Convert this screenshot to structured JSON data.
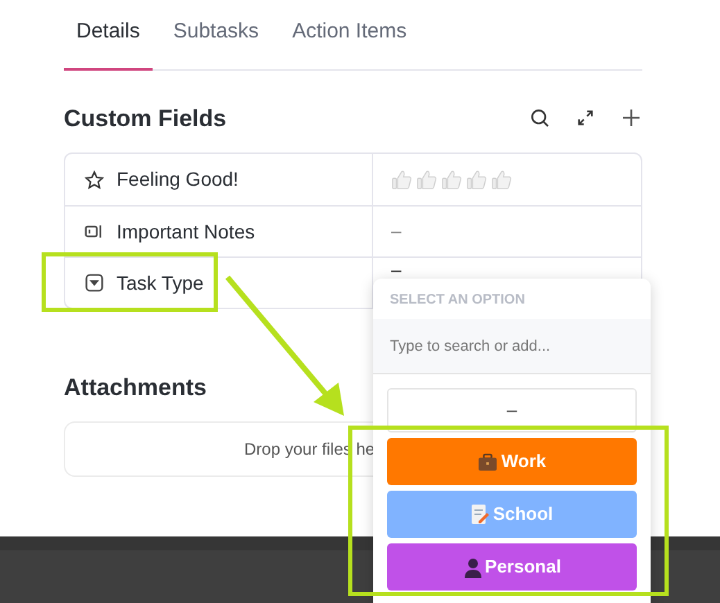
{
  "tabs": [
    {
      "label": "Details",
      "selected": true
    },
    {
      "label": "Subtasks",
      "selected": false
    },
    {
      "label": "Action Items",
      "selected": false
    }
  ],
  "custom_fields": {
    "title": "Custom Fields",
    "rows": [
      {
        "kind": "rating",
        "label": "Feeling Good!",
        "stars": 0
      },
      {
        "kind": "text",
        "label": "Important Notes",
        "value": "–"
      },
      {
        "kind": "dropdown",
        "label": "Task Type",
        "value": "–"
      }
    ]
  },
  "attachments": {
    "title": "Attachments",
    "drop_text": "Drop your files he"
  },
  "dropdown": {
    "header": "SELECT AN OPTION",
    "search": {
      "placeholder": "Type to search or add..."
    },
    "options": [
      {
        "kind": "empty",
        "label": "–"
      },
      {
        "kind": "work",
        "label": "Work",
        "color": "#ff7800"
      },
      {
        "kind": "school",
        "label": "School",
        "color": "#80b3ff"
      },
      {
        "kind": "personal",
        "label": "Personal",
        "color": "#c051e8"
      }
    ]
  }
}
